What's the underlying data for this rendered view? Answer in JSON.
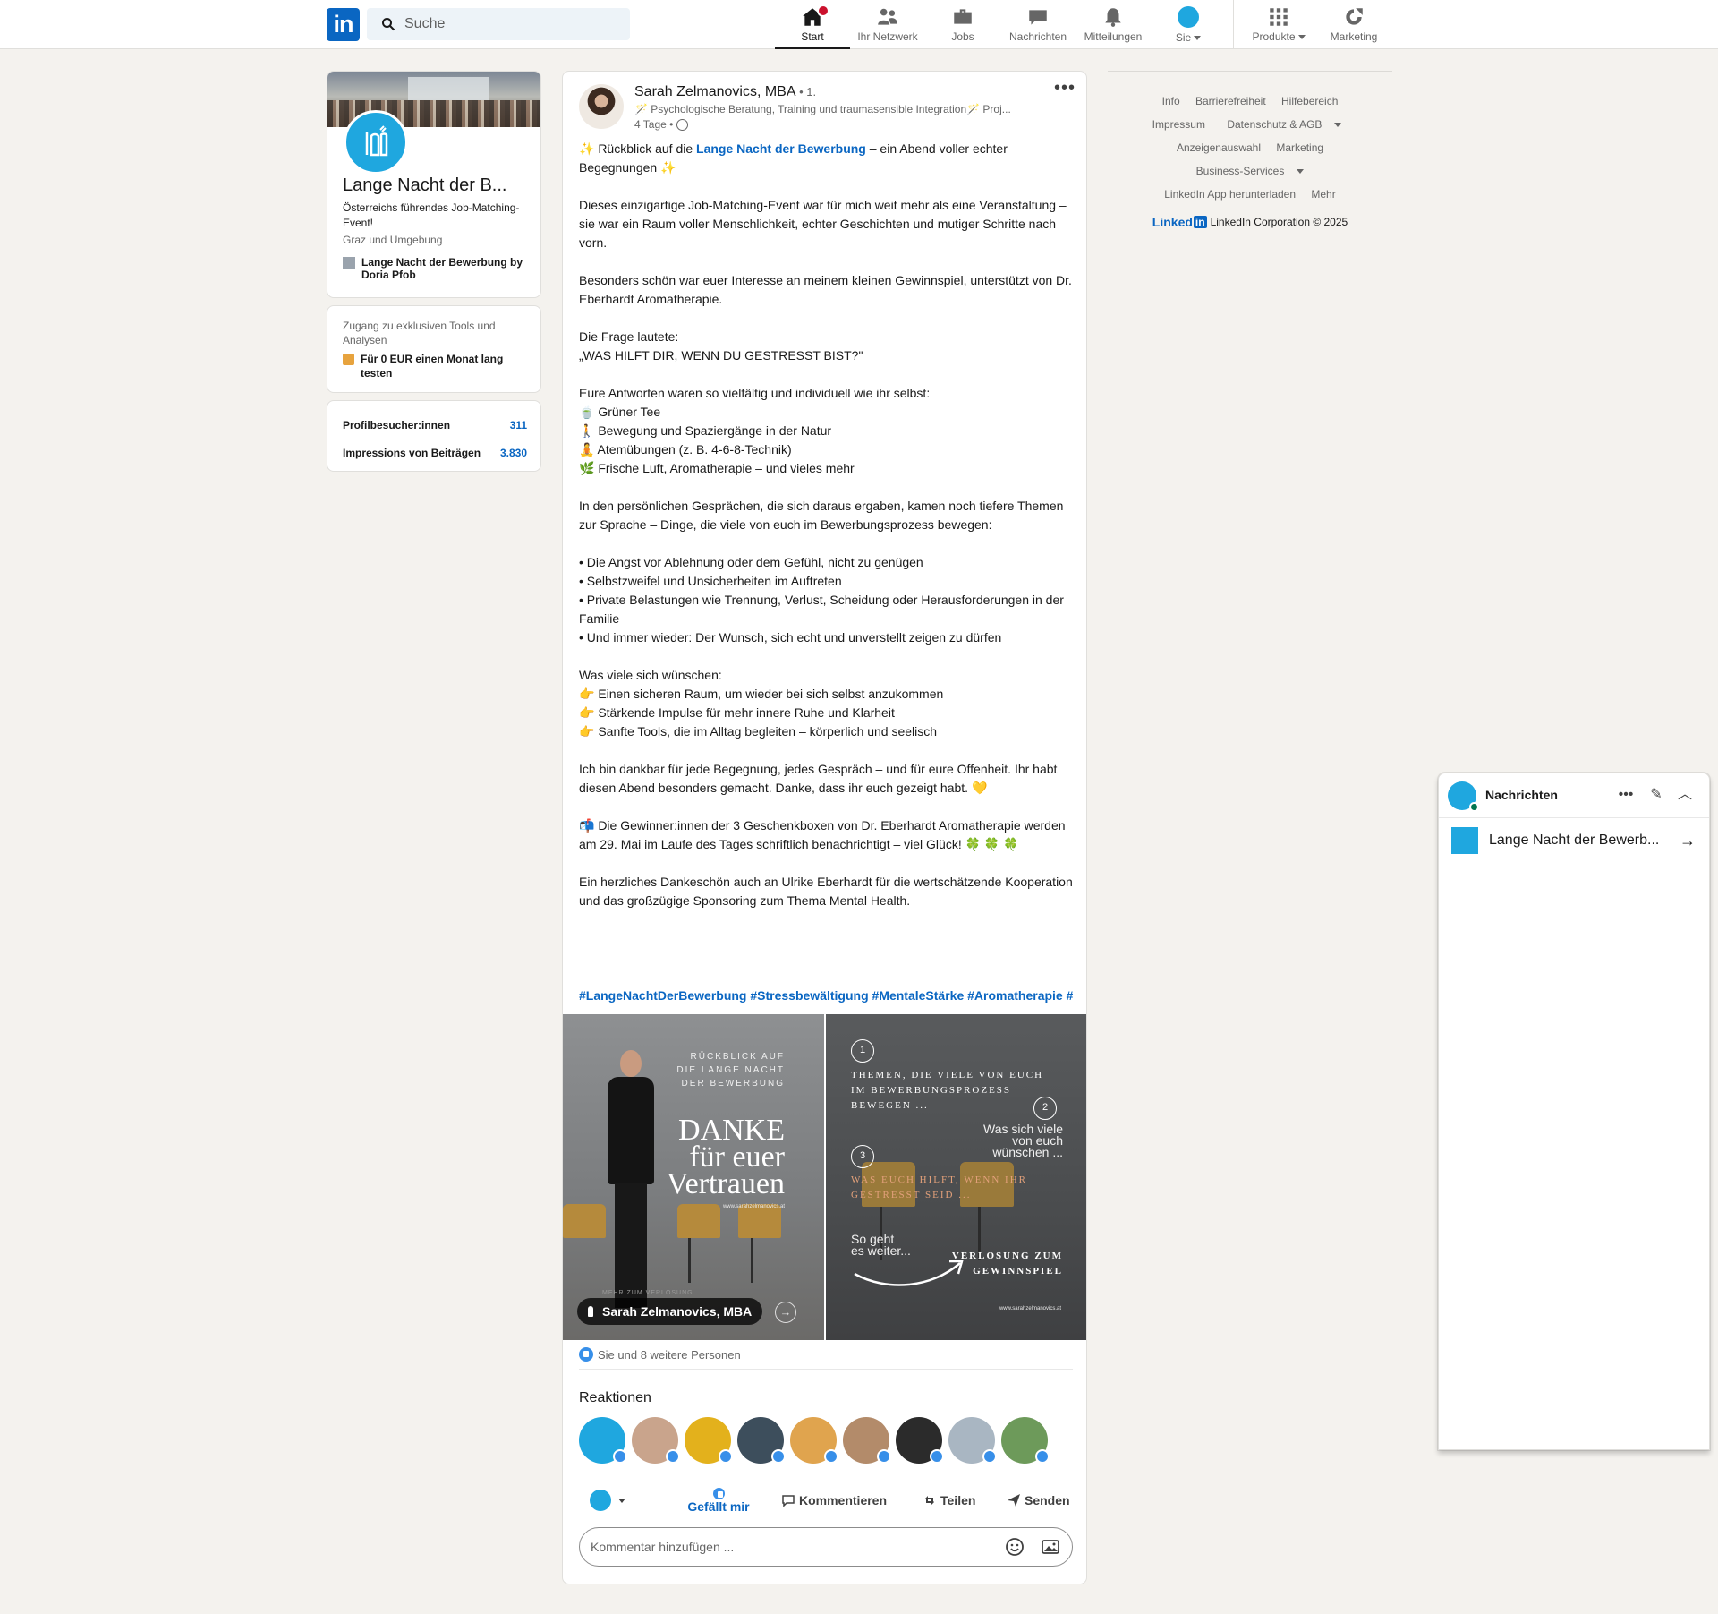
{
  "nav": {
    "logo": "in",
    "search_placeholder": "Suche",
    "items": [
      {
        "label": "Start"
      },
      {
        "label": "Ihr Netzwerk"
      },
      {
        "label": "Jobs"
      },
      {
        "label": "Nachrichten"
      },
      {
        "label": "Mitteilungen"
      },
      {
        "label": "Sie"
      },
      {
        "label": "Produkte"
      },
      {
        "label": "Marketing"
      }
    ]
  },
  "profile": {
    "name": "Lange Nacht der B...",
    "tagline": "Österreichs führendes Job-Matching-Event!",
    "location": "Graz und Umgebung",
    "page": "Lange Nacht der Bewerbung by Doria Pfob"
  },
  "premium": {
    "text": "Zugang zu exklusiven Tools und Analysen",
    "cta": "Für 0 EUR einen Monat lang testen"
  },
  "stats": [
    {
      "label": "Profilbesucher:innen",
      "value": "311"
    },
    {
      "label": "Impressions von Beiträgen",
      "value": "3.830"
    }
  ],
  "post": {
    "author": "Sarah Zelmanovics, MBA",
    "degree": " • 1.",
    "headline": "🪄 Psychologische Beratung, Training und traumasensible Integration🪄 Proj...",
    "time": "4 Tage •",
    "intro_prefix": "✨ Rückblick auf die ",
    "intro_link": "Lange Nacht der Bewerbung",
    "intro_suffix": " – ein Abend voller echter Begegnungen ✨",
    "lines": [
      "",
      "Dieses einzigartige Job-Matching-Event war für mich weit mehr als eine Veranstaltung – sie war ein Raum voller Menschlichkeit, echter Geschichten und mutiger Schritte nach vorn.",
      "",
      "Besonders schön war euer Interesse an meinem kleinen Gewinnspiel, unterstützt von Dr. Eberhardt Aromatherapie.",
      "",
      "Die Frage lautete:",
      "„WAS HILFT DIR, WENN DU GESTRESST BIST?\"",
      "",
      "Eure Antworten waren so vielfältig und individuell wie ihr selbst:",
      "🍵 Grüner Tee",
      "🚶 Bewegung und Spaziergänge in der Natur",
      "🧘 Atemübungen (z. B. 4-6-8-Technik)",
      "🌿 Frische Luft, Aromatherapie – und vieles mehr",
      "",
      "In den persönlichen Gesprächen, die sich daraus ergaben, kamen noch tiefere Themen zur Sprache – Dinge, die viele von euch im Bewerbungsprozess bewegen:",
      "",
      "• Die Angst vor Ablehnung oder dem Gefühl, nicht zu genügen",
      "• Selbstzweifel und Unsicherheiten im Auftreten",
      "• Private Belastungen wie Trennung, Verlust, Scheidung oder Herausforderungen in der Familie",
      "• Und immer wieder: Der Wunsch, sich echt und unverstellt zeigen zu dürfen",
      "",
      "Was viele sich wünschen:",
      "👉 Einen sicheren Raum, um wieder bei sich selbst anzukommen",
      "👉 Stärkende Impulse für mehr innere Ruhe und Klarheit",
      "👉 Sanfte Tools, die im Alltag begleiten – körperlich und seelisch",
      "",
      "Ich bin dankbar für jede Begegnung, jedes Gespräch – und für eure Offenheit. Ihr habt diesen Abend besonders gemacht. Danke, dass ihr euch gezeigt habt. 💛",
      "",
      "📬 Die Gewinner:innen der 3 Geschenkboxen von Dr. Eberhardt Aromatherapie werden am 29. Mai im Laufe des Tages schriftlich benachrichtigt – viel Glück! 🍀 🍀 🍀",
      "",
      "Ein herzliches Dankeschön auch an Ulrike Eberhardt für die wertschätzende Kooperation und das großzügige Sponsoring zum Thema Mental Health."
    ],
    "hashtags": "#LangeNachtDerBewerbung #Stressbewältigung #MentaleStärke #Aromatherapie #"
  },
  "image1": {
    "small": "RÜCKBLICK AUF\nDIE LANGE NACHT\nDER BEWERBUNG",
    "big1": "DANKE",
    "big2": "für euer",
    "big3": "Vertrauen",
    "site": "www.sarahzelmanovics.at",
    "tag": "Sarah Zelmanovics, MBA",
    "faded": "MEHR ZUM VERLOSUNG"
  },
  "image2": {
    "n1": "1",
    "t1": "THEMEN, DIE VIELE VON EUCH\nIM BEWERBUNGSPROZESS\nBEWEGEN ...",
    "n2": "2",
    "t2": "Was sich viele\nvon euch\nwünschen ...",
    "n3": "3",
    "t3": "WAS EUCH HILFT, WENN IHR\nGESTRESST SEID ...",
    "t4": "So geht\nes weiter...",
    "t5": "VERLOSUNG ZUM\nGEWINNSPIEL",
    "site": "www.sarahzelmanovics.at"
  },
  "engagement": {
    "likes": "Sie und 8 weitere Personen",
    "reactions_title": "Reaktionen",
    "reactor_colors": [
      "#1fa7df",
      "#c9a48c",
      "#e3b11c",
      "#3d4e5c",
      "#e0a44e",
      "#b38b6a",
      "#2b2b2b",
      "#a9b6c2",
      "#6d9a5a"
    ],
    "like": "Gefällt mir",
    "comment": "Kommentieren",
    "share": "Teilen",
    "send": "Senden",
    "comment_placeholder": "Kommentar hinzufügen ..."
  },
  "footer": {
    "row1": [
      "Info",
      "Barrierefreiheit",
      "Hilfebereich"
    ],
    "row2": [
      "Impressum",
      "Datenschutz & AGB"
    ],
    "row3": [
      "Anzeigenauswahl",
      "Marketing"
    ],
    "row4": [
      "Business-Services"
    ],
    "row5": [
      "LinkedIn App herunterladen",
      "Mehr"
    ],
    "brand": "Linked",
    "brand_box": "in",
    "copyright": "LinkedIn Corporation © 2025"
  },
  "messaging": {
    "title": "Nachrichten",
    "conversation": "Lange Nacht der Bewerb...",
    "more": "•••",
    "compose": "✎",
    "collapse": "︿",
    "open": "→"
  },
  "colors": {
    "brand": "#0a66c2",
    "org": "#1fa7df",
    "background": "#f4f2ee"
  }
}
